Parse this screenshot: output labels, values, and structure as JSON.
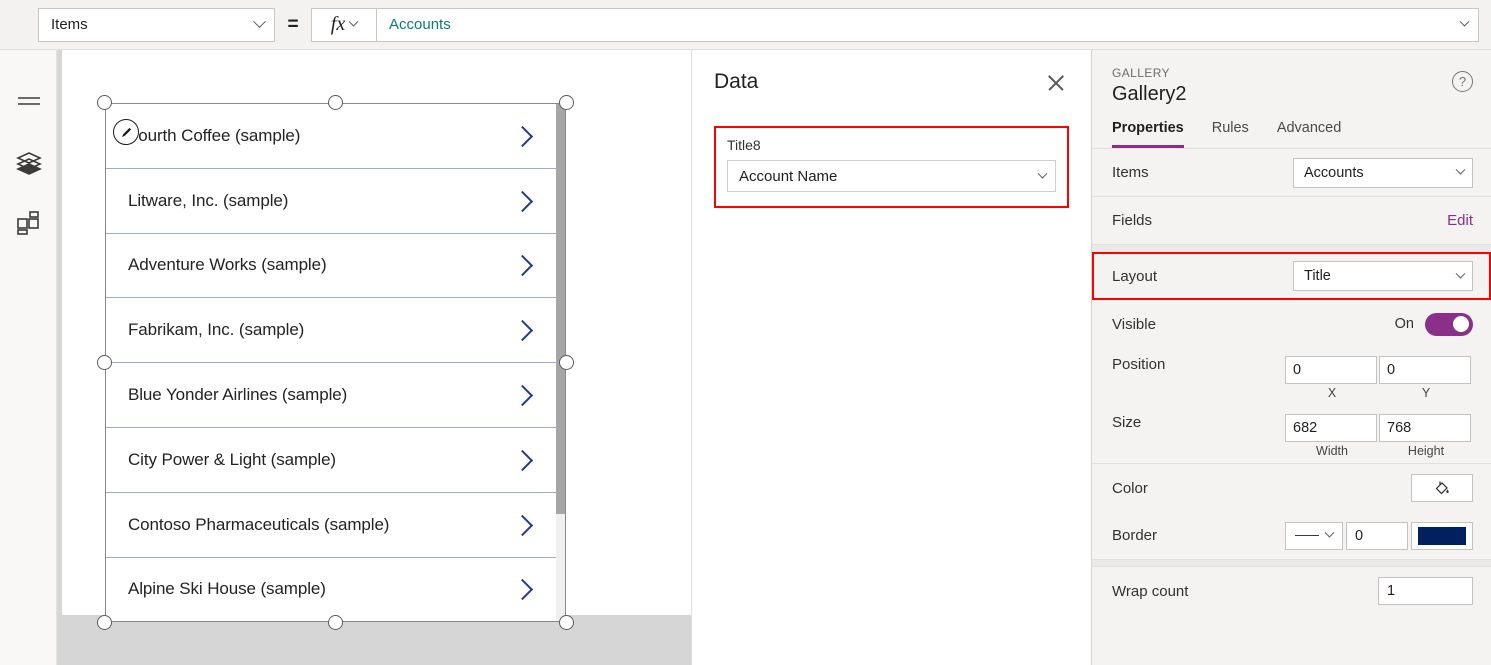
{
  "formula_bar": {
    "property_select": "Items",
    "equals": "=",
    "fx_label": "fx",
    "formula_value": "Accounts"
  },
  "left_rail": {
    "items": [
      {
        "name": "hamburger-menu-icon",
        "label": "Menu"
      },
      {
        "name": "tree-view-icon",
        "label": "Tree view"
      },
      {
        "name": "insert-icon",
        "label": "Insert"
      }
    ]
  },
  "canvas": {
    "gallery": {
      "items": [
        "Fourth Coffee (sample)",
        "Litware, Inc. (sample)",
        "Adventure Works (sample)",
        "Fabrikam, Inc. (sample)",
        "Blue Yonder Airlines (sample)",
        "City Power & Light (sample)",
        "Contoso Pharmaceuticals (sample)",
        "Alpine Ski House (sample)"
      ],
      "chevron_color": "#1f3a93",
      "separator_color": "#a0a8d0"
    }
  },
  "data_pane": {
    "title": "Data",
    "close_label": "Close",
    "field": {
      "label": "Title8",
      "value": "Account Name"
    },
    "highlight_color": "#ff0000"
  },
  "properties_pane": {
    "kicker": "GALLERY",
    "component_name": "Gallery2",
    "help_label": "?",
    "tabs": [
      {
        "label": "Properties",
        "active": true
      },
      {
        "label": "Rules",
        "active": false
      },
      {
        "label": "Advanced",
        "active": false
      }
    ],
    "accent_color": "#8a2f8a",
    "rows": {
      "items": {
        "label": "Items",
        "value": "Accounts"
      },
      "fields": {
        "label": "Fields",
        "action": "Edit"
      },
      "layout": {
        "label": "Layout",
        "value": "Title",
        "highlighted": true
      },
      "visible": {
        "label": "Visible",
        "state": "On"
      },
      "position": {
        "label": "Position",
        "x": "0",
        "y": "0",
        "x_sub": "X",
        "y_sub": "Y"
      },
      "size": {
        "label": "Size",
        "width": "682",
        "height": "768",
        "width_sub": "Width",
        "height_sub": "Height"
      },
      "color": {
        "label": "Color",
        "icon": "fill-bucket-icon"
      },
      "border": {
        "label": "Border",
        "style": "solid",
        "width": "0",
        "color": "#002060"
      },
      "wrap_count": {
        "label": "Wrap count",
        "value": "1"
      }
    }
  }
}
